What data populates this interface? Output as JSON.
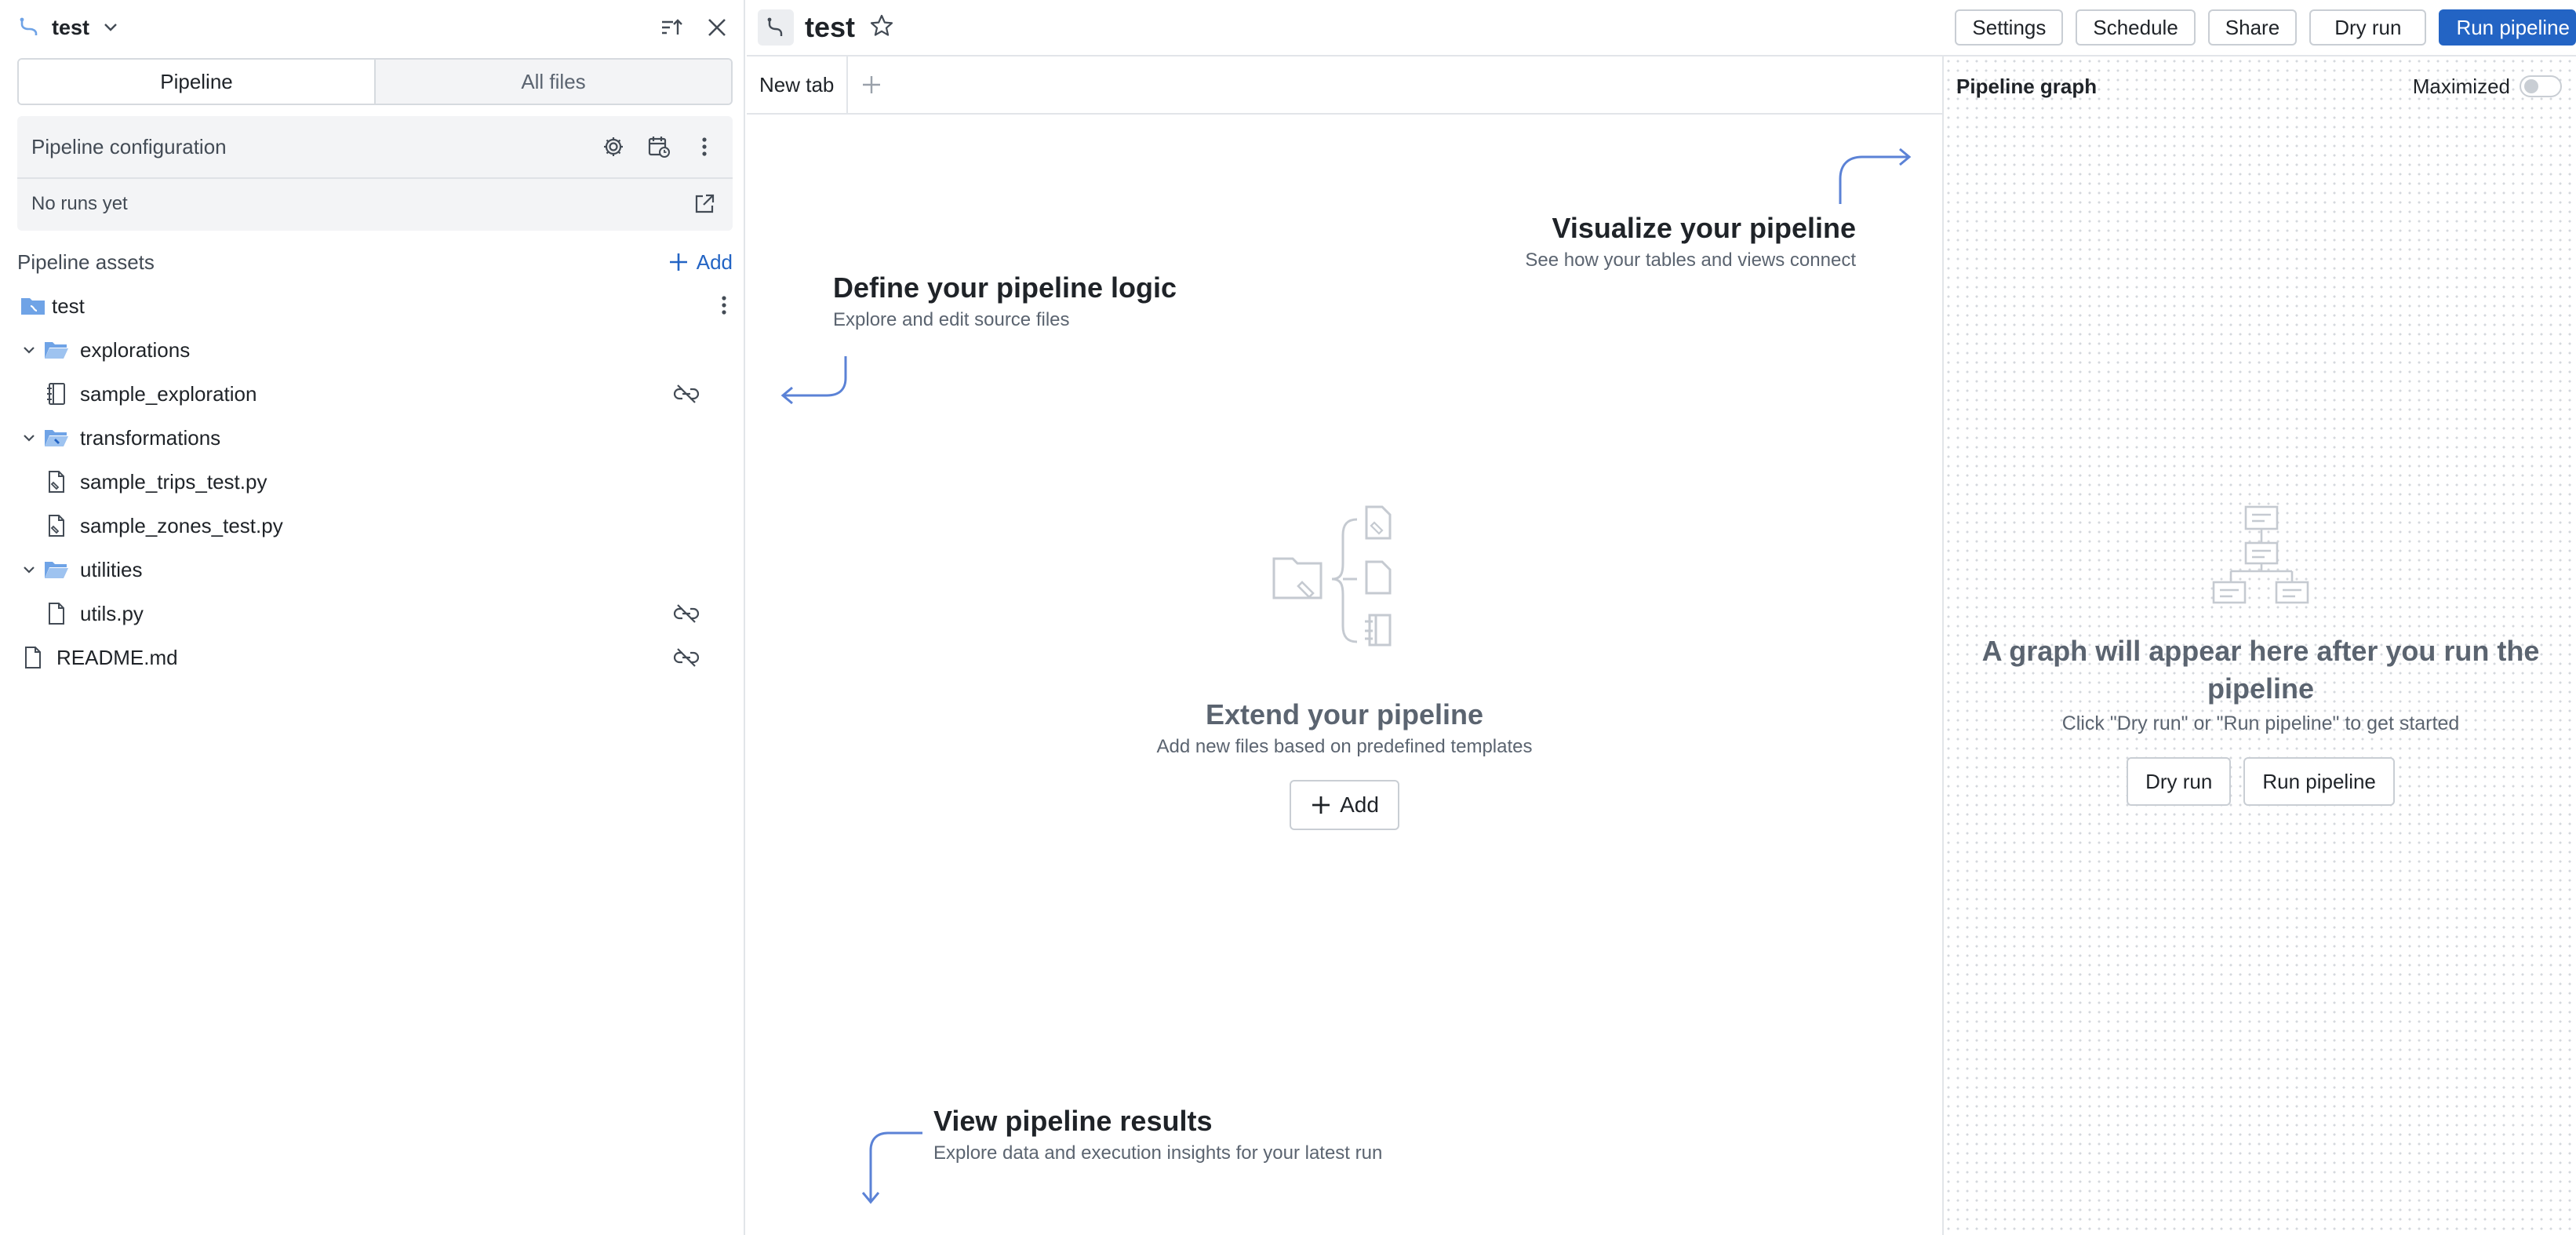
{
  "sidebar": {
    "pipeline_name": "test",
    "segments": [
      "Pipeline",
      "All files"
    ],
    "config_label": "Pipeline configuration",
    "runs_label": "No runs yet",
    "assets_label": "Pipeline assets",
    "add_label": "Add",
    "tree": {
      "root": "test",
      "explorations": "explorations",
      "sample_exploration": "sample_exploration",
      "transformations": "transformations",
      "sample_trips": "sample_trips_test.py",
      "sample_zones": "sample_zones_test.py",
      "utilities": "utilities",
      "utils": "utils.py",
      "readme": "README.md"
    }
  },
  "topbar": {
    "title": "test",
    "settings": "Settings",
    "schedule": "Schedule",
    "share": "Share",
    "dry_run": "Dry run",
    "run_pipeline": "Run pipeline"
  },
  "tabs": {
    "new_tab": "New tab"
  },
  "center": {
    "visualize_title": "Visualize your pipeline",
    "visualize_sub": "See how your tables and views connect",
    "define_title": "Define your pipeline logic",
    "define_sub": "Explore and edit source files",
    "extend_title": "Extend your pipeline",
    "extend_sub": "Add new files based on predefined templates",
    "add_label": "Add",
    "results_title": "View pipeline results",
    "results_sub": "Explore data and execution insights for your latest run"
  },
  "graph": {
    "title": "Pipeline graph",
    "maximized_label": "Maximized",
    "maximized": false,
    "empty_title": "A graph will appear here after you run the pipeline",
    "empty_sub": "Click \"Dry run\" or \"Run pipeline\" to get started",
    "dry_run": "Dry run",
    "run_pipeline": "Run pipeline"
  },
  "colors": {
    "accent": "#2364c4",
    "hint_arrow": "#5b82d6",
    "folder": "#6fa3e6"
  }
}
